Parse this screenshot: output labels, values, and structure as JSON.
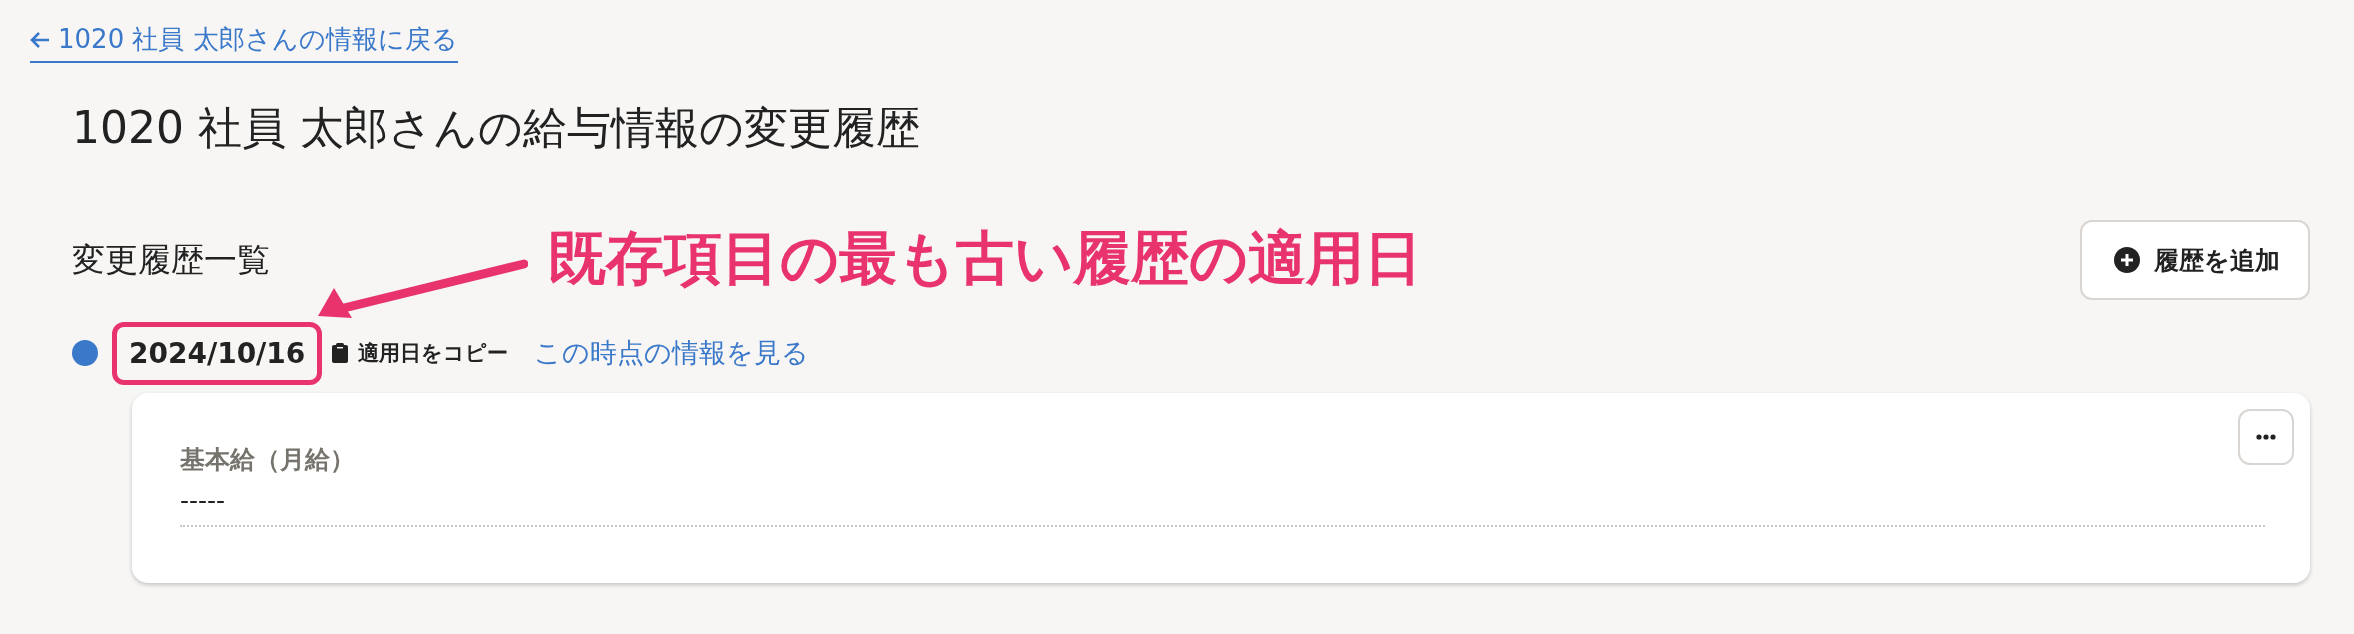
{
  "back_link": {
    "label": "1020 社員 太郎さんの情報に戻る"
  },
  "title": "1020 社員 太郎さんの給与情報の変更履歴",
  "section": {
    "heading": "変更履歴一覧",
    "add_button": "履歴を追加"
  },
  "history": [
    {
      "date": "2024/10/16",
      "highlighted": true,
      "copy_label": "適用日をコピー",
      "view_link": "この時点の情報を見る",
      "fields": [
        {
          "label": "基本給（月給）",
          "value": "-----"
        }
      ]
    }
  ],
  "annotation": {
    "text": "既存項目の最も古い履歴の適用日"
  }
}
